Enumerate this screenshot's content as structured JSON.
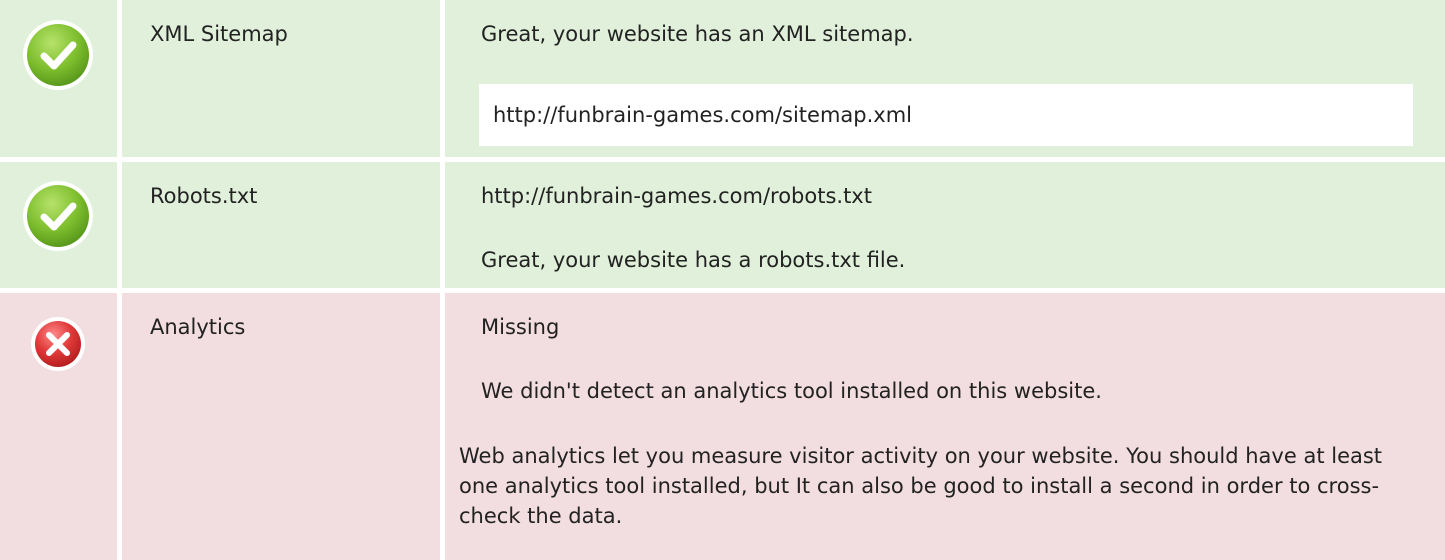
{
  "colors": {
    "pass_bg": "#e0f0da",
    "fail_bg": "#f2dde0",
    "pass_icon": "#7fbf2f",
    "fail_icon": "#e03a3a"
  },
  "rows": [
    {
      "status": "pass",
      "icon": "check-circle-icon",
      "name": "XML Sitemap",
      "message": "Great, your website has an XML sitemap.",
      "url": "http://funbrain-games.com/sitemap.xml"
    },
    {
      "status": "pass",
      "icon": "check-circle-icon",
      "name": "Robots.txt",
      "url": "http://funbrain-games.com/robots.txt",
      "message": "Great, your website has a robots.txt file."
    },
    {
      "status": "fail",
      "icon": "x-circle-icon",
      "name": "Analytics",
      "status_text": "Missing",
      "message": "We didn't detect an analytics tool installed on this website.",
      "description": "Web analytics let you measure visitor activity on your website. You should have at least one analytics tool installed, but It can also be good to install a second in order to cross-check the data."
    }
  ]
}
